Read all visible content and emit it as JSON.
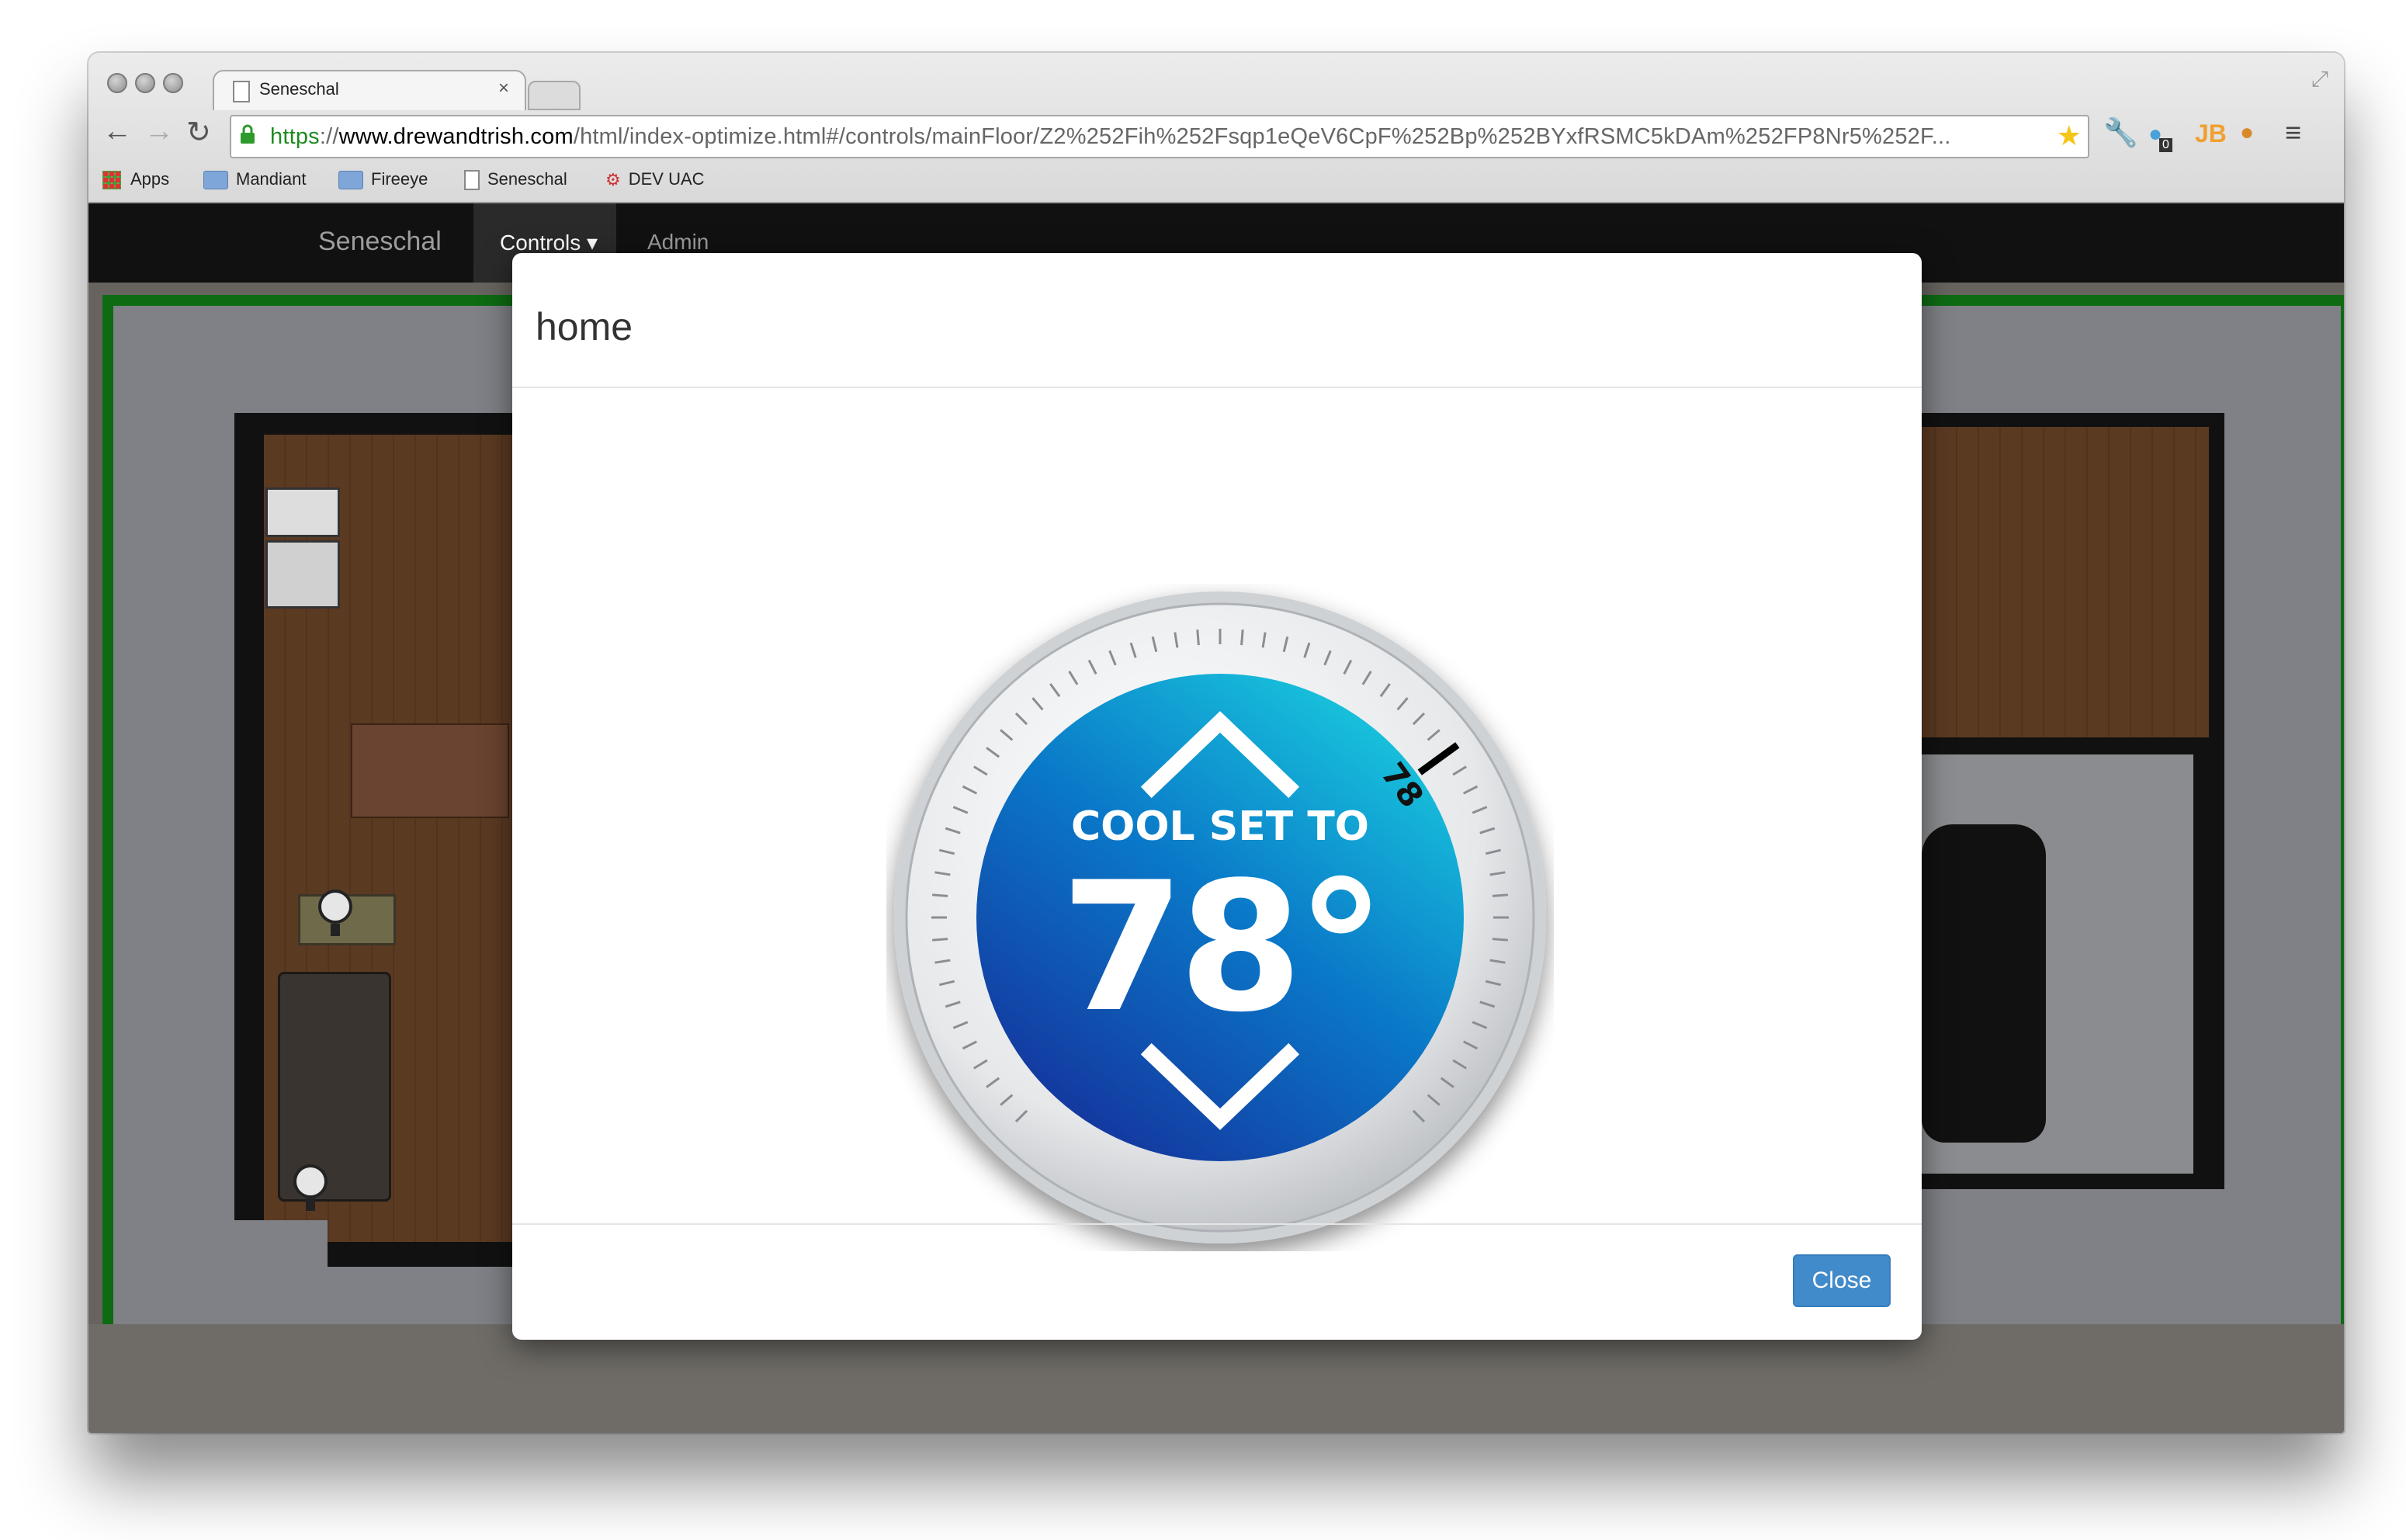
{
  "browser": {
    "tab_title": "Seneschal",
    "tab_close": "×",
    "url_scheme": "https",
    "url_sep": "://",
    "url_host": "www.drewandtrish.com",
    "url_path": "/html/index-optimize.html#/controls/mainFloor/Z2%252Fih%252Fsqp1eQeV6CpF%252Bp%252BYxfRSMC5kDAm%252FP8Nr5%252F...",
    "back": "←",
    "forward": "→",
    "reload": "↻",
    "star": "★",
    "ext_jb": "JB",
    "ext_badge": "0",
    "bookmarks": [
      "Apps",
      "Mandiant",
      "Fireeye",
      "Seneschal",
      "DEV UAC"
    ]
  },
  "app_nav": {
    "brand": "Seneschal",
    "controls": "Controls ▾",
    "admin": "Admin ▾"
  },
  "modal": {
    "title": "home",
    "close_label": "Close"
  },
  "thermostat": {
    "mode_label": "COOL SET TO",
    "setpoint": 78,
    "setpoint_display": "78°",
    "marker_label": "78",
    "colors": {
      "dial_inner": "#0e8fd0",
      "dial_outer": "#1b3fa0",
      "bezel": "#d9dcdf"
    }
  }
}
